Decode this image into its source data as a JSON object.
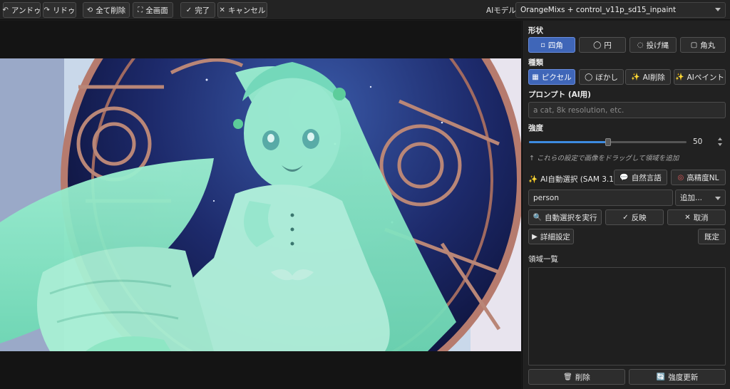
{
  "toolbar": {
    "undo_label": "アンドゥ",
    "redo_label": "リドゥ",
    "clear_all_label": "全て削除",
    "fullscreen_label": "全画面",
    "done_label": "完了",
    "cancel_label": "キャンセル",
    "model_label": "AIモデル",
    "model_value": "OrangeMixs + control_v11p_sd15_inpaint"
  },
  "panel": {
    "shape_title": "形状",
    "shapes": [
      {
        "label": "四角",
        "icon": "square-icon",
        "active": true
      },
      {
        "label": "円",
        "icon": "circle-icon",
        "active": false
      },
      {
        "label": "投げ縄",
        "icon": "lasso-icon",
        "active": false
      },
      {
        "label": "角丸",
        "icon": "rounded-square-icon",
        "active": false
      }
    ],
    "type_title": "種類",
    "types": [
      {
        "label": "ピクセル",
        "icon": "pixel-icon",
        "active": true
      },
      {
        "label": "ぼかし",
        "icon": "blur-icon",
        "active": false
      },
      {
        "label": "AI削除",
        "icon": "sparkle-icon",
        "active": false
      },
      {
        "label": "AIペイント",
        "icon": "sparkle-icon",
        "active": false
      }
    ],
    "prompt_title": "プロンプト (AI用)",
    "prompt_placeholder": "a cat, 8k resolution, etc.",
    "strength_title": "強度",
    "strength_value": "50",
    "strength_fraction": 0.5,
    "hint": "↑ これらの設定で画像をドラッグして領域を追加",
    "sam_title": "AI自動選択 (SAM 3.1)",
    "natural_lang_label": "自然言語",
    "high_precision_label": "高精度NL",
    "sam_input_value": "person",
    "add_select_value": "追加...",
    "run_label": "自動選択を実行",
    "apply_label": "反映",
    "cancel_label": "取消",
    "advanced_label": "詳細設定",
    "default_label": "既定",
    "region_list_title": "領域一覧",
    "delete_label": "削除",
    "update_strength_label": "強度更新"
  },
  "colors": {
    "accent": "#3f66b8",
    "panel_bg": "#212121",
    "mask_overlay": "#7fe8b8"
  }
}
